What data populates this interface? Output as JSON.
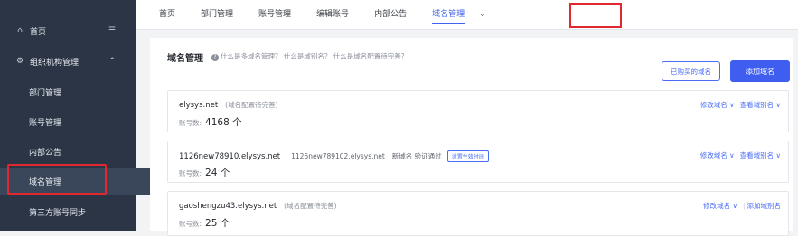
{
  "sidebar": {
    "items": [
      {
        "label": "首页",
        "icon": "home-icon",
        "trail": "☰"
      },
      {
        "label": "组织机构管理",
        "icon": "org-icon",
        "trail": "^"
      },
      {
        "label": "部门管理"
      },
      {
        "label": "账号管理"
      },
      {
        "label": "内部公告"
      },
      {
        "label": "域名管理"
      },
      {
        "label": "第三方账号同步"
      }
    ]
  },
  "topnav": {
    "tabs": [
      "首页",
      "部门管理",
      "账号管理",
      "编辑账号",
      "内部公告",
      "域名管理"
    ],
    "active": "域名管理",
    "more_icon": "chevron-down-icon"
  },
  "main": {
    "title": "域名管理",
    "help": "什么是多域名管理？ 什么是域别名？ 什么是域名配置待完善？",
    "purchased_btn": "已购买的域名",
    "add_btn": "添加域名",
    "count_label": "账号数:",
    "domains": [
      {
        "name": "elysys.net",
        "extra": "(域名配置待完善)",
        "alias": "",
        "alias_status": "",
        "badge": "",
        "count": "4168 个",
        "action1": "修改域名 ∨",
        "action2": "查看域别名 ∨"
      },
      {
        "name": "1126new78910.elysys.net",
        "extra": "",
        "alias": "1126new789102.elysys.net",
        "alias_status": "新域名 验证通过",
        "badge": "设置生效时间",
        "count": "24 个",
        "action1": "修改域名 ∨",
        "action2": "查看域别名 ∨"
      },
      {
        "name": "gaoshengzu43.elysys.net",
        "extra": "(域名配置待完善)",
        "alias": "",
        "alias_status": "",
        "badge": "",
        "count": "25 个",
        "action1": "修改域名 ∨",
        "action2": "添加域别名"
      }
    ]
  },
  "colors": {
    "accent": "#3f5ef0",
    "sidebar_bg": "#2b3546",
    "highlight": "#e0282e"
  }
}
